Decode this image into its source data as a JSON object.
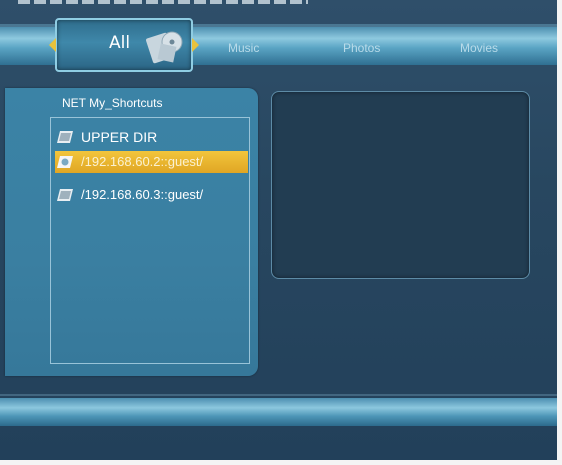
{
  "tabs": {
    "all_label": "All",
    "items": [
      {
        "label": "Music"
      },
      {
        "label": "Photos"
      },
      {
        "label": "Movies"
      }
    ]
  },
  "browser": {
    "path": "NET  My_Shortcuts",
    "rows": [
      {
        "label": "UPPER DIR",
        "icon": "folder-icon"
      },
      {
        "label": "/192.168.60.2::guest/",
        "icon": "network-folder-icon",
        "selected": true
      },
      {
        "label": "/192.168.60.3::guest/",
        "icon": "folder-icon"
      }
    ]
  },
  "colors": {
    "selection": "#e8b52e",
    "accent": "#8ec9df",
    "background": "#284760"
  }
}
